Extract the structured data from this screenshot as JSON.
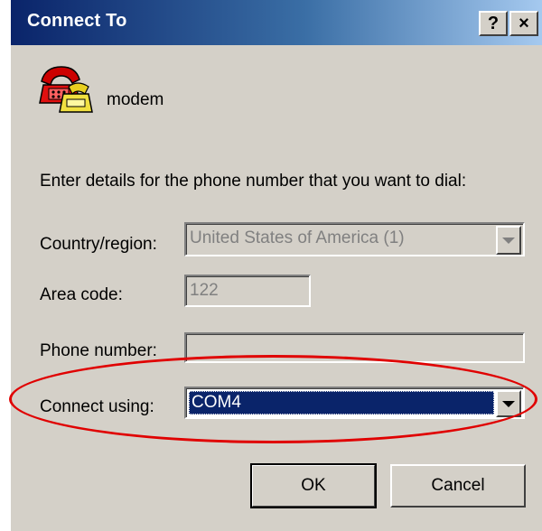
{
  "dialog": {
    "title": "Connect To",
    "help_button": "?",
    "close_button": "×",
    "connection_name": "modem",
    "instructions": "Enter details for the phone number that you want to dial:"
  },
  "form": {
    "country_label": "Country/region:",
    "country_value": "United States of America (1)",
    "area_code_label": "Area code:",
    "area_code_value": "122",
    "phone_label": "Phone number:",
    "phone_value": "",
    "connect_using_label": "Connect using:",
    "connect_using_value": "COM4"
  },
  "buttons": {
    "ok": "OK",
    "cancel": "Cancel"
  },
  "colors": {
    "title_bar": "#0a246a",
    "highlight": "#0a246a",
    "annotation": "#e00000"
  }
}
